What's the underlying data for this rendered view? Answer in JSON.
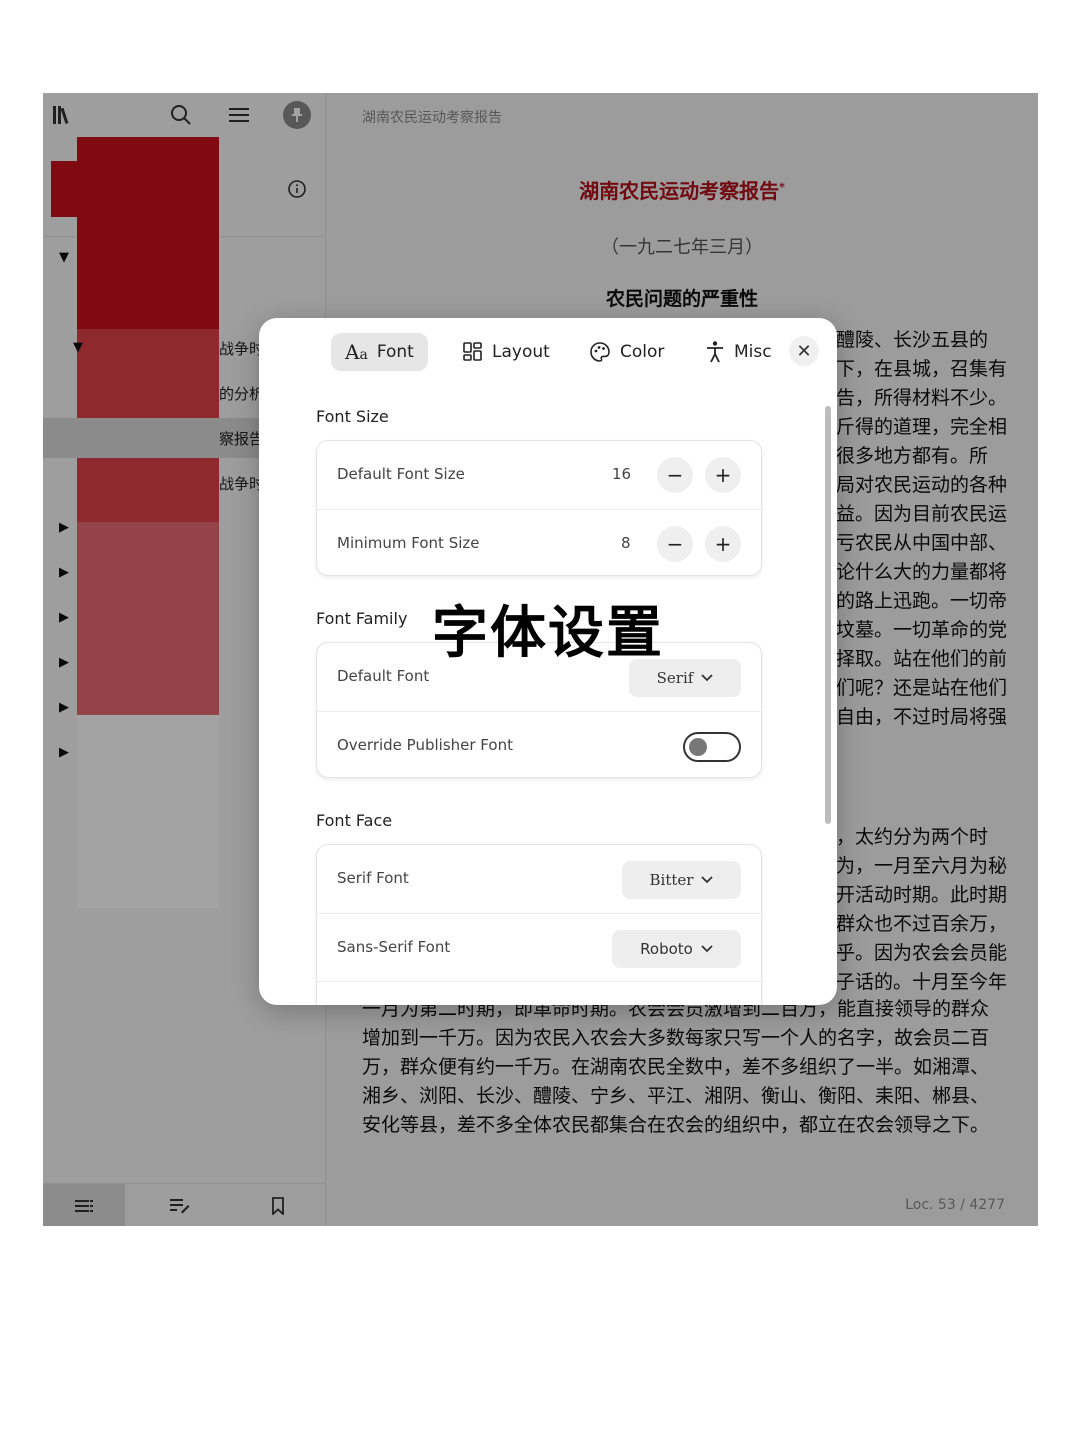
{
  "header": {
    "book_title": "湖南农民运动考察报告"
  },
  "document": {
    "title": "湖南农民运动考察报告",
    "title_mark": "*",
    "date": "（一九二七年三月）",
    "heading": "农民问题的严重性",
    "right_lines": [
      "醴陵、长沙五县的",
      "下，在县城，召集有",
      "告，所得材料不少。",
      "斤得的道理，完全相",
      "很多地方都有。所",
      "局对农民运动的各种",
      "益。因为目前农民运",
      "亏农民从中国中部、",
      "论什么大的力量都将",
      "的路上迅跑。一切帝",
      "坟墓。一切革命的党",
      "择取。站在他们的前",
      "们呢？还是站在他们",
      "自由，不过时局将强",
      "",
      "",
      "",
      "，太约分为两个时",
      "为，一月至六月为秘",
      "开活动时期。此时期",
      "群众也不过百余万，",
      "乎。因为农会会员能",
      "子话的。十月至今年"
    ],
    "bottom_paragraph": "一月为第二时期，即革命时期。农会会员激增到二百万，能直接领导的群众增加到一千万。因为农民入农会大多数每家只写一个人的名字，故会员二百万，群众便有约一千万。在湖南农民全数中，差不多组织了一半。如湘潭、湘乡、浏阳、长沙、醴陵、宁乡、平江、湘阴、衡山、衡阳、耒阳、郴县、安化等县，差不多全体农民都集合在农会的组织中，都立在农会领导之下。",
    "location": "Loc. 53 / 4277"
  },
  "sidebar": {
    "toc": [
      {
        "text": "",
        "triangle": "▼"
      },
      {
        "text": "",
        "triangle": ""
      },
      {
        "text": "战争时",
        "triangle": "▼"
      },
      {
        "text": "的分析",
        "triangle": ""
      },
      {
        "text": "察报告",
        "triangle": ""
      },
      {
        "text": "战争时",
        "triangle": ""
      },
      {
        "text": "",
        "triangle": "▶"
      },
      {
        "text": "",
        "triangle": "▶"
      },
      {
        "text": "",
        "triangle": "▶"
      },
      {
        "text": "",
        "triangle": "▶"
      },
      {
        "text": "",
        "triangle": "▶"
      },
      {
        "text": "",
        "triangle": "▶"
      }
    ]
  },
  "settings": {
    "tabs": [
      {
        "label": "Font",
        "icon": "font-icon"
      },
      {
        "label": "Layout",
        "icon": "layout-icon"
      },
      {
        "label": "Color",
        "icon": "palette-icon"
      },
      {
        "label": "Misc",
        "icon": "accessibility-icon"
      }
    ],
    "font_size": {
      "section": "Font Size",
      "default_label": "Default Font Size",
      "default_value": "16",
      "minimum_label": "Minimum Font Size",
      "minimum_value": "8"
    },
    "font_family": {
      "section": "Font Family",
      "default_font_label": "Default Font",
      "default_font_value": "Serif",
      "override_label": "Override Publisher Font",
      "override_on": false
    },
    "font_face": {
      "section": "Font Face",
      "serif_label": "Serif Font",
      "serif_value": "Bitter",
      "sans_label": "Sans-Serif Font",
      "sans_value": "Roboto"
    }
  },
  "caption": "字体设置",
  "colors": {
    "accent": "#b1121c",
    "cover_red": "#c8101b"
  }
}
